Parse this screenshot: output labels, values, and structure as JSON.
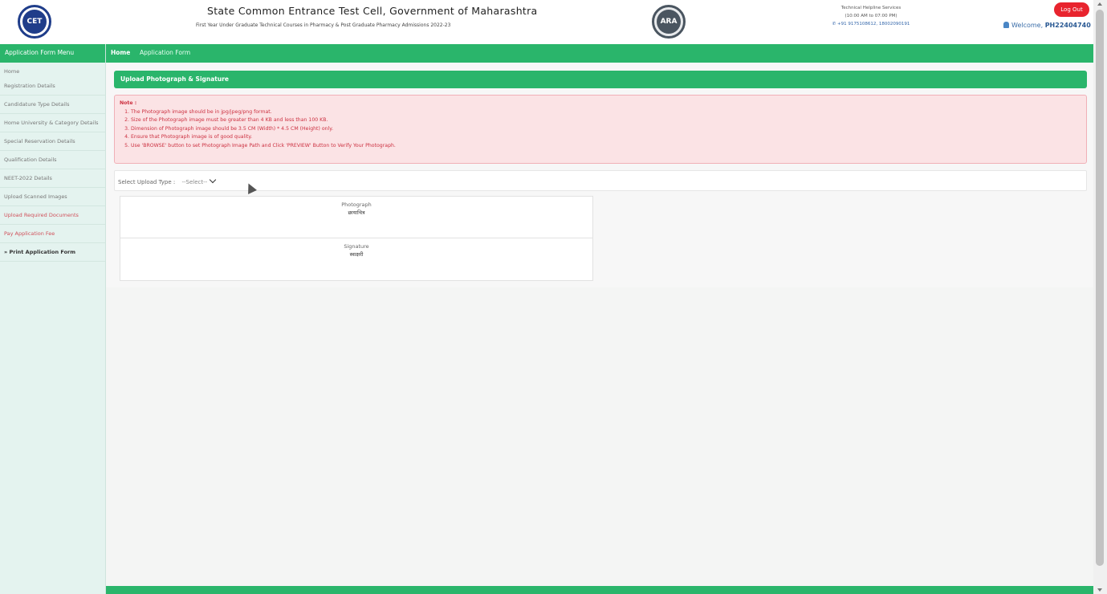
{
  "header": {
    "logo_left": "CET",
    "title": "State Common Entrance Test Cell, Government of Maharashtra",
    "subtitle": "First Year Under Graduate Technical Courses in Pharmacy & Post Graduate Pharmacy Admissions 2022-23",
    "logo_right": "ARA",
    "helpline": {
      "title": "Technical Helpline Services",
      "hours": "(10:00 AM to 07:00 PM)",
      "phone": "+91 9175108612, 18002090191"
    },
    "logout_label": "Log Out",
    "welcome_label": "Welcome,",
    "user_id": "PH22404740"
  },
  "sidebar": {
    "title": "Application Form Menu",
    "items": [
      {
        "label": "Home"
      },
      {
        "label": "Registration Details"
      },
      {
        "label": "Candidature Type Details"
      },
      {
        "label": "Home University & Category Details"
      },
      {
        "label": "Special Reservation Details"
      },
      {
        "label": "Qualification Details"
      },
      {
        "label": "NEET-2022 Details"
      },
      {
        "label": "Upload Scanned Images"
      },
      {
        "label": "Upload Required Documents"
      },
      {
        "label": "Pay Application Fee"
      },
      {
        "label": "Print Application Form"
      }
    ]
  },
  "breadcrumb": {
    "home": "Home",
    "current": "Application Form"
  },
  "panel": {
    "title": "Upload Photograph & Signature"
  },
  "note": {
    "label": "Note :",
    "items": [
      "The Photograph image should be in jpg/jpeg/png format.",
      "Size of the Photograph image must be greater than 4 KB and less than 100 KB.",
      "Dimension of Photograph image should be 3.5 CM (Width) * 4.5 CM (Height) only.",
      "Ensure that Photograph image is of good quality.",
      "Use 'BROWSE' button to set Photograph Image Path and Click 'PREVIEW' Button to Verify Your Photograph."
    ]
  },
  "selector": {
    "label": "Select Upload Type :",
    "value": "--Select--"
  },
  "upload": {
    "photo_label": "Photograph",
    "photo_label_mr": "छायाचित्र",
    "sign_label": "Signature",
    "sign_label_mr": "स्वाक्षरी"
  },
  "colors": {
    "accent_green": "#2ab56b",
    "logout_red": "#e8242e",
    "note_bg": "#fbe3e5",
    "note_text": "#cc3040"
  }
}
